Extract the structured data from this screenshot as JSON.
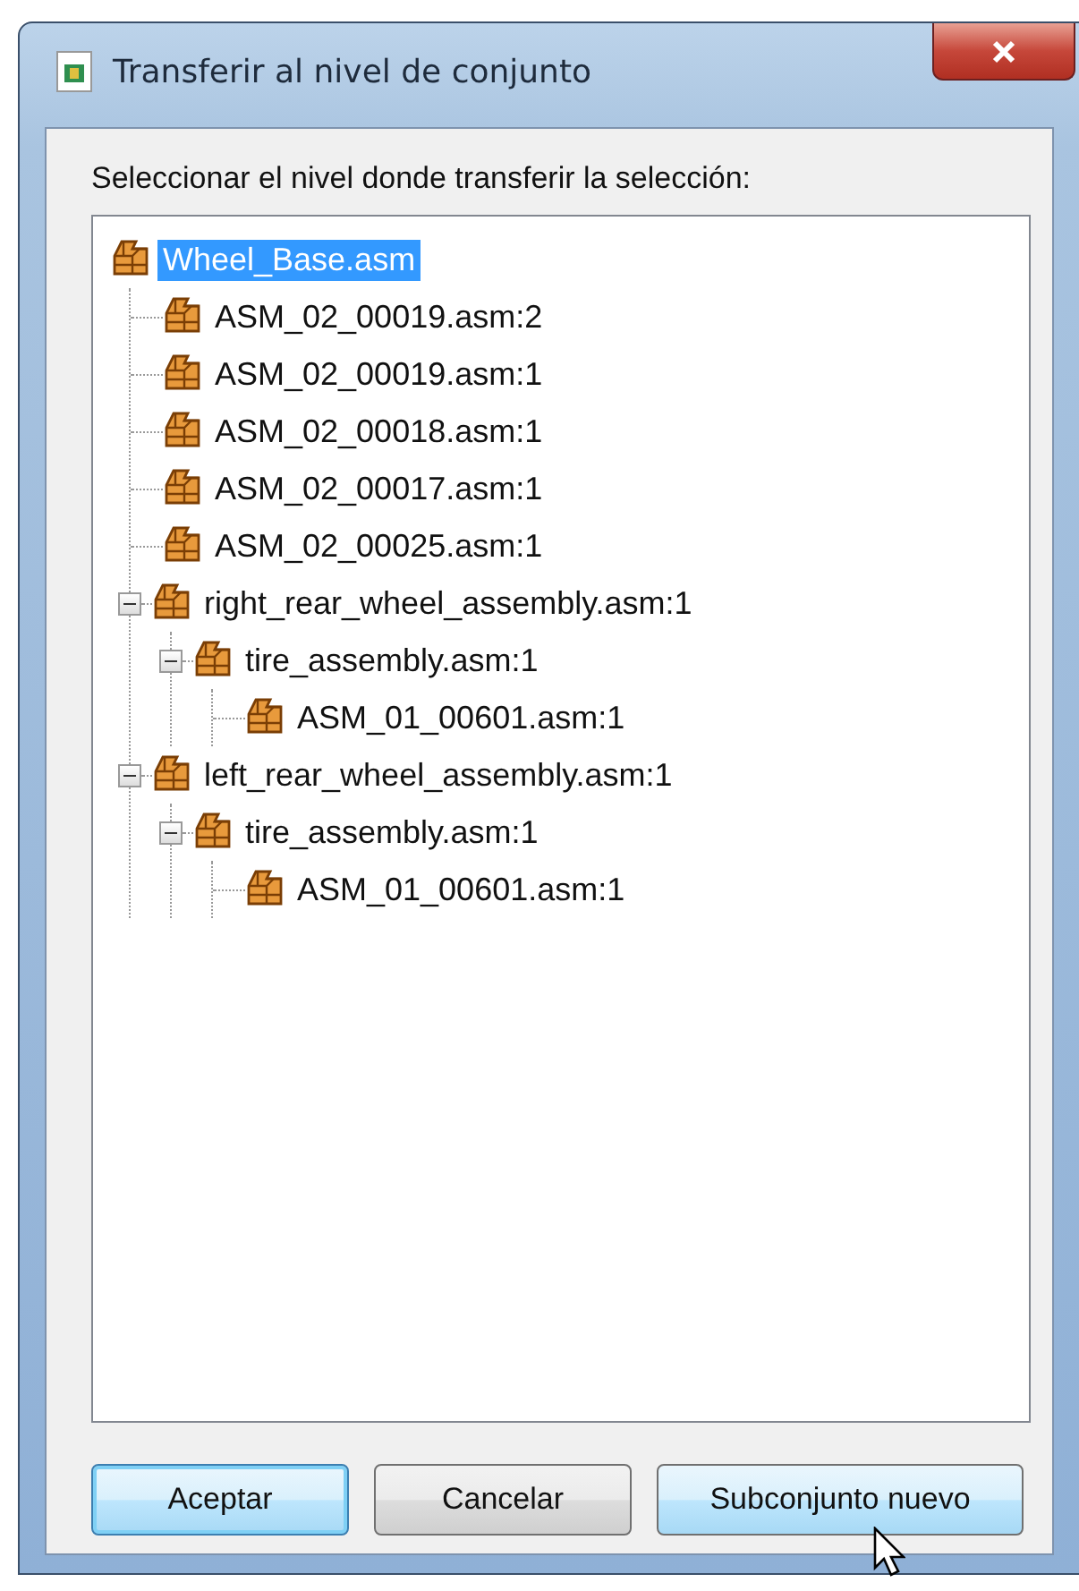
{
  "window": {
    "title": "Transferir al nivel de conjunto"
  },
  "prompt": "Seleccionar el nivel donde transferir la selección:",
  "tree": [
    {
      "label": "Wheel_Base.asm",
      "selected": true,
      "children": [
        {
          "label": "ASM_02_00019.asm:2",
          "selected": false
        },
        {
          "label": "ASM_02_00019.asm:1",
          "selected": false
        },
        {
          "label": "ASM_02_00018.asm:1",
          "selected": false
        },
        {
          "label": "ASM_02_00017.asm:1",
          "selected": false
        },
        {
          "label": "ASM_02_00025.asm:1",
          "selected": false
        },
        {
          "label": "right_rear_wheel_assembly.asm:1",
          "selected": false,
          "expanded": true,
          "children": [
            {
              "label": "tire_assembly.asm:1",
              "selected": false,
              "expanded": true,
              "children": [
                {
                  "label": "ASM_01_00601.asm:1",
                  "selected": false
                }
              ]
            }
          ]
        },
        {
          "label": "left_rear_wheel_assembly.asm:1",
          "selected": false,
          "expanded": true,
          "children": [
            {
              "label": "tire_assembly.asm:1",
              "selected": false,
              "expanded": true,
              "children": [
                {
                  "label": "ASM_01_00601.asm:1",
                  "selected": false
                }
              ]
            }
          ]
        }
      ]
    }
  ],
  "buttons": [
    {
      "label": "Aceptar",
      "kind": "default"
    },
    {
      "label": "Cancelar",
      "kind": "normal"
    },
    {
      "label": "Subconjunto nuevo",
      "kind": "hover"
    }
  ]
}
